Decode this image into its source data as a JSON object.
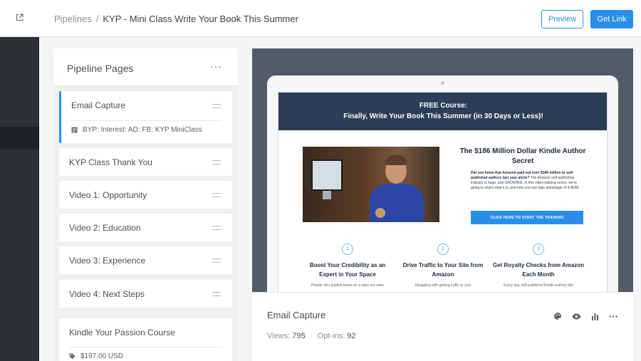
{
  "header": {
    "breadcrumb_root": "Pipelines",
    "breadcrumb_separator": "/",
    "breadcrumb_current": "KYP - Mini Class Write Your Book This Summer",
    "preview_label": "Preview",
    "get_link_label": "Get Link"
  },
  "sidebar": {
    "external_link_icon": "external-link-icon"
  },
  "pipeline_panel": {
    "title": "Pipeline Pages",
    "more_label": "···",
    "pages": [
      {
        "name": "Email Capture",
        "subtitle": "BYP: Interest: AD: FB: KYP MiniClass",
        "active": true
      },
      {
        "name": "KYP Class Thank You"
      },
      {
        "name": "Video 1: Opportunity"
      },
      {
        "name": "Video 2: Education"
      },
      {
        "name": "Video 3: Experience"
      },
      {
        "name": "Video 4: Next Steps"
      }
    ],
    "product": {
      "name": "Kindle Your Passion Course",
      "price": "$197.00 USD"
    }
  },
  "preview": {
    "hero_line1": "FREE Course:",
    "hero_line2": "Finally, Write Your Book This Summer (in 30 Days or Less)!",
    "offer_title": "The $186 Million Dollar Kindle Author Secret",
    "offer_text_bold": "Did you know that Amazon paid out over $186 million to self-published authors last year alone?",
    "offer_text": " The Amazon self-publishing industry is huge, and GROWING. In this video training series, we're going to share what it is, and how you can take advantage of it NOW.",
    "offer_button": "CLICK HERE TO START THE TRAINING",
    "features": [
      {
        "num": "1",
        "title": "Boost Your Credibility as an Expert in Your Space",
        "desc": "People who publish books on a topic are seen"
      },
      {
        "num": "2",
        "title": "Drive Traffic to Your Site from Amazon",
        "desc": "Struggling with getting traffic to your"
      },
      {
        "num": "3",
        "title": "Get Royalty Checks from Amazon Each Month",
        "desc": "Every day, self-published Kindle authors like"
      }
    ]
  },
  "page_info": {
    "title": "Email Capture",
    "views_label": "Views:",
    "views_value": "795",
    "optins_label": "Opt-ins:",
    "optins_value": "92"
  },
  "colors": {
    "accent": "#2a8ee8",
    "rail": "#2d3136",
    "preview_bg": "#535b68",
    "hero_bar": "#2c3e55"
  }
}
